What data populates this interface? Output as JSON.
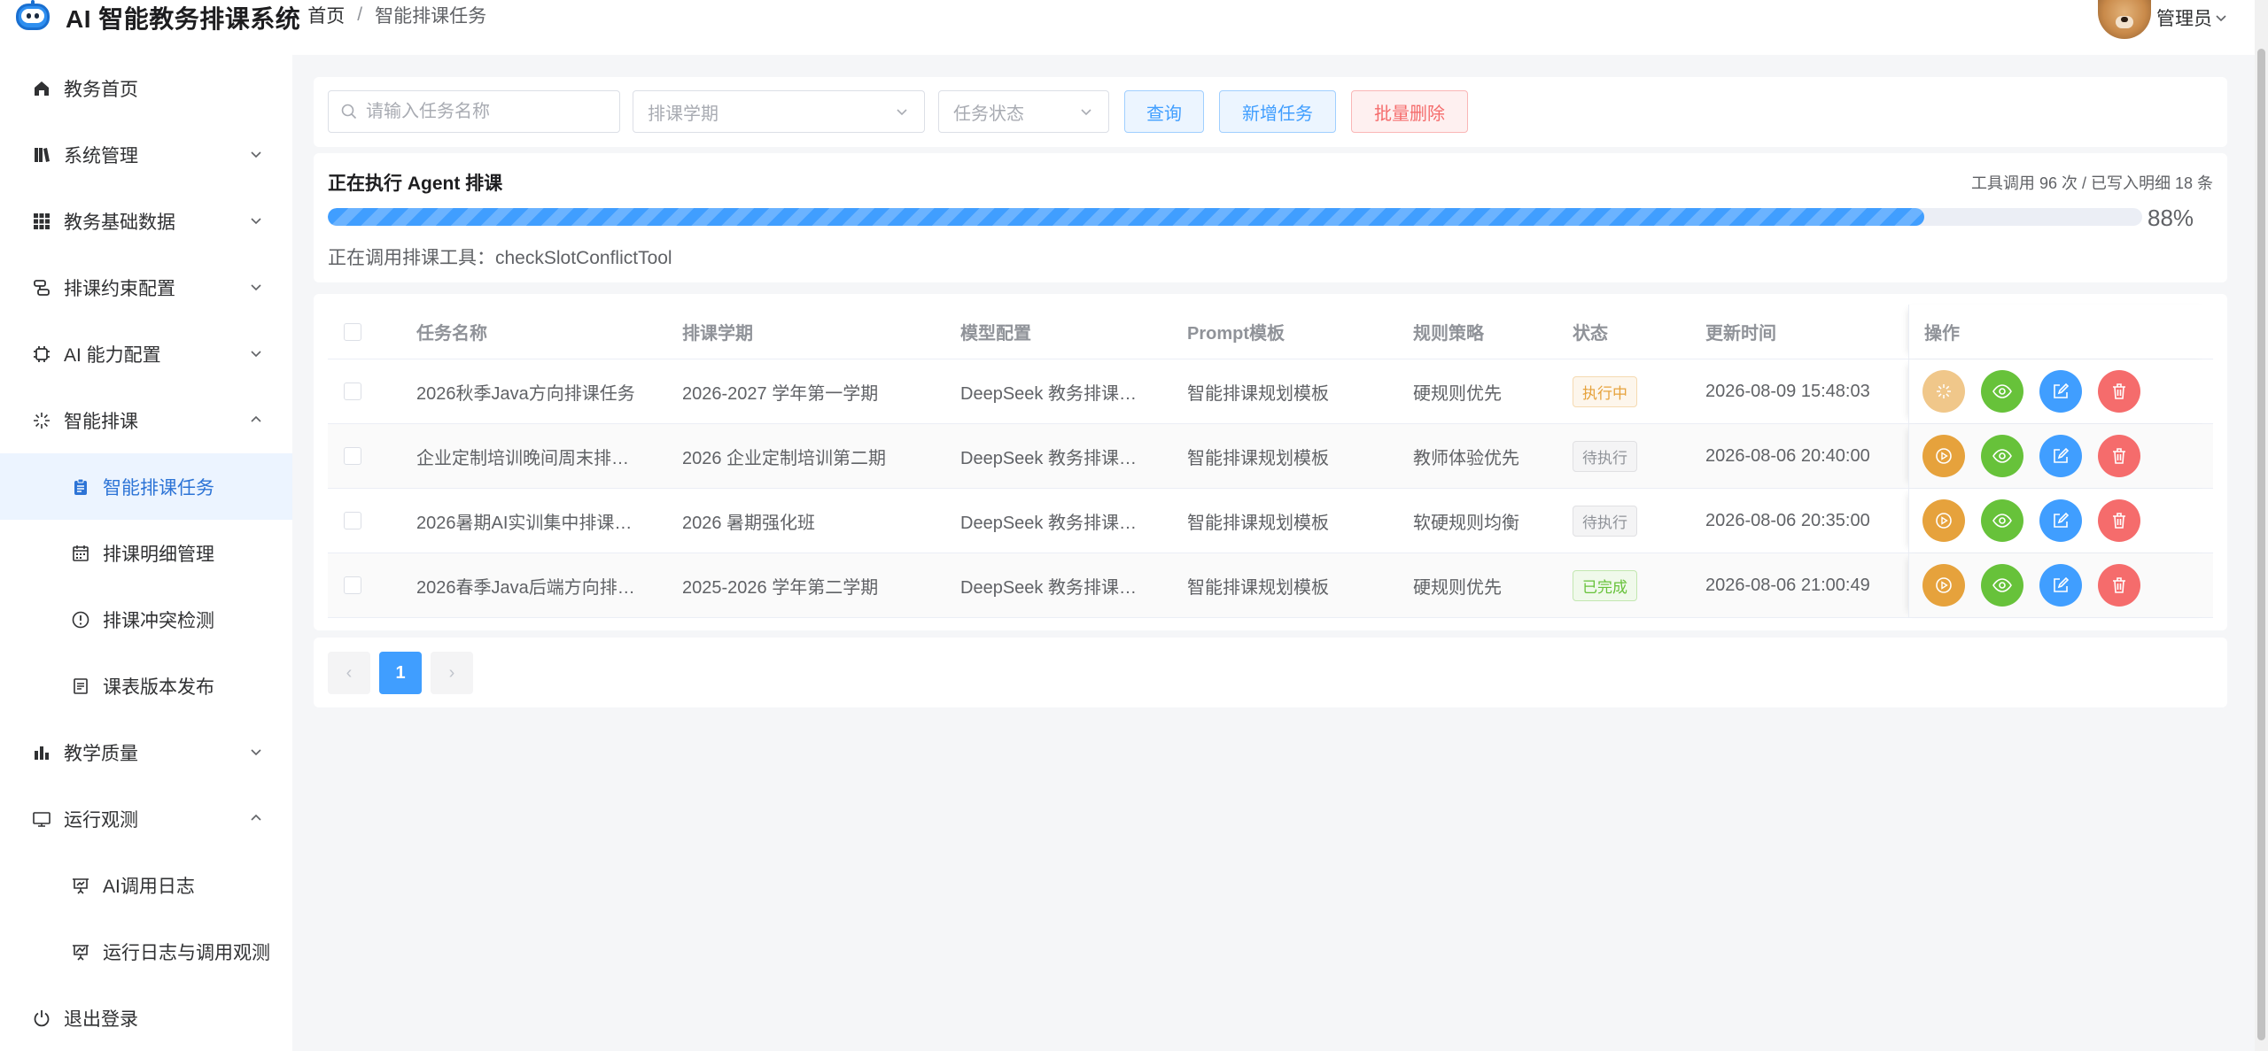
{
  "header": {
    "app_title": "AI 智能教务排课系统",
    "breadcrumb": [
      "首页",
      "智能排课任务"
    ],
    "breadcrumb_sep": "/",
    "user_name": "管理员"
  },
  "sidebar": {
    "items": [
      {
        "label": "教务首页",
        "icon": "home-icon"
      },
      {
        "label": "系统管理",
        "icon": "book-icon"
      },
      {
        "label": "教务基础数据",
        "icon": "grid-icon"
      },
      {
        "label": "排课约束配置",
        "icon": "constraint-icon"
      },
      {
        "label": "AI 能力配置",
        "icon": "chip-icon"
      },
      {
        "label": "智能排课",
        "icon": "spark-icon"
      },
      {
        "label": "智能排课任务",
        "icon": "clipboard-icon"
      },
      {
        "label": "排课明细管理",
        "icon": "calendar-icon"
      },
      {
        "label": "排课冲突检测",
        "icon": "alert-icon"
      },
      {
        "label": "课表版本发布",
        "icon": "document-icon"
      },
      {
        "label": "教学质量",
        "icon": "bar-chart-icon"
      },
      {
        "label": "运行观测",
        "icon": "monitor-icon"
      },
      {
        "label": "AI调用日志",
        "icon": "presentation-icon"
      },
      {
        "label": "运行日志与调用观测",
        "icon": "trend-icon"
      },
      {
        "label": "退出登录",
        "icon": "power-icon"
      }
    ]
  },
  "toolbar": {
    "search_placeholder": "请输入任务名称",
    "term_placeholder": "排课学期",
    "status_placeholder": "任务状态",
    "query_label": "查询",
    "add_label": "新增任务",
    "batch_delete_label": "批量删除"
  },
  "progress": {
    "title": "正在执行 Agent 排课",
    "meta": "工具调用 96 次 / 已写入明细 18 条",
    "percent": 88,
    "percent_text": "88%",
    "tool_text": "正在调用排课工具：checkSlotConflictTool"
  },
  "table": {
    "columns": [
      "任务名称",
      "排课学期",
      "模型配置",
      "Prompt模板",
      "规则策略",
      "状态",
      "更新时间",
      "操作"
    ],
    "rows": [
      {
        "name": "2026秋季Java方向排课任务",
        "term": "2026-2027 学年第一学期",
        "model": "DeepSeek 教务排课…",
        "prompt": "智能排课规划模板",
        "rule": "硬规则优先",
        "status": "执行中",
        "status_type": "run",
        "updated": "2026-08-09 15:48:03"
      },
      {
        "name": "企业定制培训晚间周末排…",
        "term": "2026 企业定制培训第二期",
        "model": "DeepSeek 教务排课…",
        "prompt": "智能排课规划模板",
        "rule": "教师体验优先",
        "status": "待执行",
        "status_type": "wait",
        "updated": "2026-08-06 20:40:00"
      },
      {
        "name": "2026暑期AI实训集中排课…",
        "term": "2026 暑期强化班",
        "model": "DeepSeek 教务排课…",
        "prompt": "智能排课规划模板",
        "rule": "软硬规则均衡",
        "status": "待执行",
        "status_type": "wait",
        "updated": "2026-08-06 20:35:00"
      },
      {
        "name": "2026春季Java后端方向排…",
        "term": "2025-2026 学年第二学期",
        "model": "DeepSeek 教务排课…",
        "prompt": "智能排课规划模板",
        "rule": "硬规则优先",
        "status": "已完成",
        "status_type": "done",
        "updated": "2026-08-06 21:00:49"
      }
    ]
  },
  "pagination": {
    "prev": "‹",
    "current": "1",
    "next": "›"
  },
  "colors": {
    "primary": "#409eff",
    "success": "#67c23a",
    "warning": "#e6a23c",
    "danger": "#f56c6c",
    "active_bg": "#ecf4ff"
  }
}
